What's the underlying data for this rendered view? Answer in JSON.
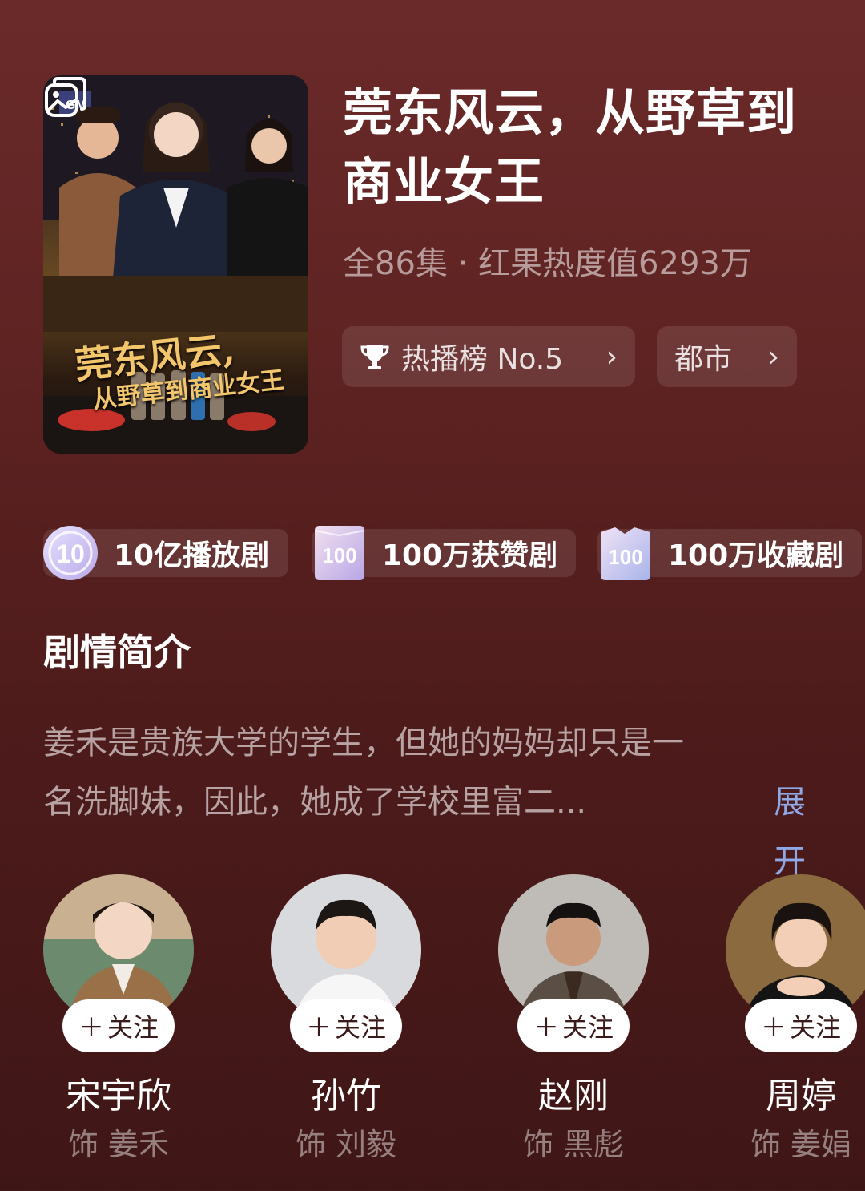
{
  "drama": {
    "title": "莞东风云，从野草到商业女王",
    "meta": "全86集 · 红果热度值6293万",
    "poster_title_line1": "莞东风云,",
    "poster_title_line2": "从野草到商业女王",
    "rank_label": "热播榜 No.5",
    "genre_label": "都市",
    "chevron": "›"
  },
  "badges": [
    {
      "icon": "10-badge-icon",
      "label": "10亿播放剧"
    },
    {
      "icon": "100-badge-icon",
      "label": "100万获赞剧"
    },
    {
      "icon": "100-badge-icon",
      "label": "100万收藏剧"
    }
  ],
  "synopsis": {
    "heading": "剧情简介",
    "line1": "姜禾是贵族大学的学生，但她的妈妈却只是一",
    "line2": "名洗脚妹，因此，她成了学校里富二...",
    "expand_label": "展开"
  },
  "cast": [
    {
      "name": "宋宇欣",
      "role": "饰 姜禾",
      "follow": "关注"
    },
    {
      "name": "孙竹",
      "role": "饰 刘毅",
      "follow": "关注"
    },
    {
      "name": "赵刚",
      "role": "饰 黑彪",
      "follow": "关注"
    },
    {
      "name": "周婷",
      "role": "饰 姜娟",
      "follow": "关注"
    }
  ],
  "colors": {
    "background": "#5e2322",
    "expand_link": "#8fa8e6",
    "poster_title": "#f3c66b"
  }
}
